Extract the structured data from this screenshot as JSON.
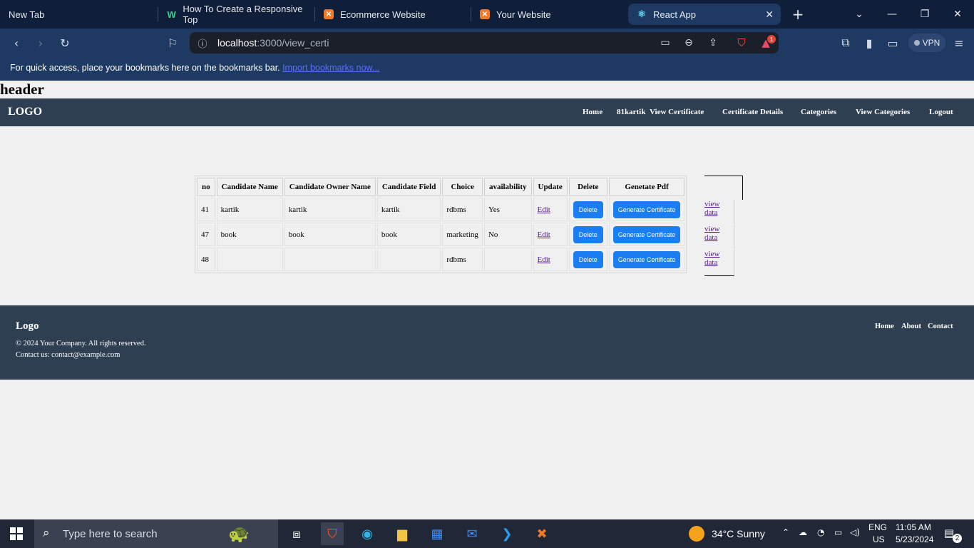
{
  "browser": {
    "tabs": [
      {
        "title": "New Tab"
      },
      {
        "title": "How To Create a Responsive Top"
      },
      {
        "title": "Ecommerce Website"
      },
      {
        "title": "Your Website"
      },
      {
        "title": "React App"
      }
    ],
    "url_host": "localhost",
    "url_path": ":3000/view_certi",
    "vpn_label": "VPN",
    "brave_badge": "1",
    "bookmarks_msg": "For quick access, place your bookmarks here on the bookmarks bar.",
    "bookmarks_link": "Import bookmarks now..."
  },
  "page": {
    "header_text": "header",
    "nav": {
      "logo": "LOGO",
      "links": [
        "Home",
        "81kartik",
        "View Certificate",
        "Certificate Details",
        "Categories",
        "View Categories",
        "Logout"
      ]
    },
    "table": {
      "columns": [
        "no",
        "Candidate Name",
        "Candidate Owner Name",
        "Candidate Field",
        "Choice",
        "availability",
        "Update",
        "Delete",
        "Genetate Pdf"
      ],
      "rows": [
        {
          "no": "41",
          "name": "kartik",
          "owner": "kartik",
          "field": "kartik",
          "choice": "rdbms",
          "availability": "Yes"
        },
        {
          "no": "47",
          "name": "book",
          "owner": "book",
          "field": "book",
          "choice": "marketing",
          "availability": "No"
        },
        {
          "no": "48",
          "name": "",
          "owner": "",
          "field": "",
          "choice": "rdbms",
          "availability": ""
        }
      ],
      "edit_label": "Edit",
      "delete_label": "Delete",
      "generate_label": "Generate Certificate",
      "view_label": "view data"
    },
    "footer": {
      "logo": "Logo",
      "copyright": "© 2024 Your Company. All rights reserved.",
      "contact": "Contact us: contact@example.com",
      "links": [
        "Home",
        "About",
        "Contact"
      ]
    }
  },
  "taskbar": {
    "search_placeholder": "Type here to search",
    "weather": "34°C  Sunny",
    "lang1": "ENG",
    "lang2": "US",
    "time": "11:05 AM",
    "date": "5/23/2024",
    "notif_count": "2"
  }
}
